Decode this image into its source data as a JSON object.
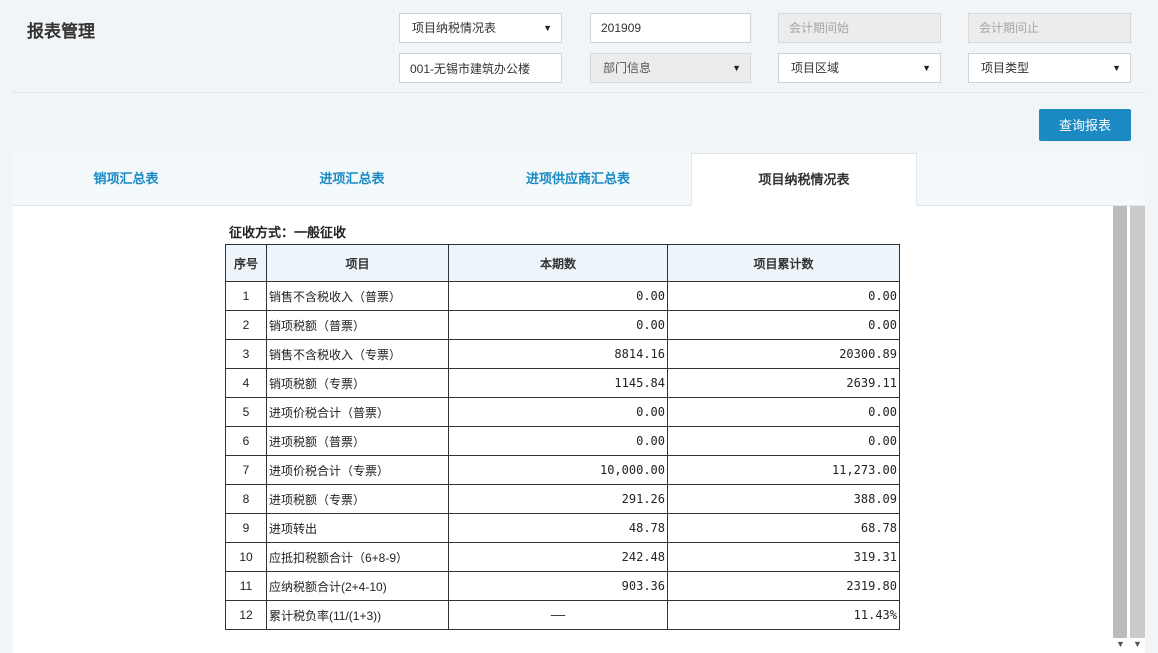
{
  "page": {
    "title": "报表管理"
  },
  "filters": {
    "report_type": {
      "value": "项目纳税情况表"
    },
    "period": {
      "value": "201909"
    },
    "period_start": {
      "placeholder": "会计期间始"
    },
    "period_end": {
      "placeholder": "会计期间止"
    },
    "project": {
      "value": "001-无锡市建筑办公楼"
    },
    "department": {
      "value": "部门信息"
    },
    "region": {
      "value": "项目区域"
    },
    "project_type": {
      "value": "项目类型"
    }
  },
  "query_button": {
    "label": "查询报表"
  },
  "tabs": [
    {
      "label": "销项汇总表",
      "active": false
    },
    {
      "label": "进项汇总表",
      "active": false
    },
    {
      "label": "进项供应商汇总表",
      "active": false
    },
    {
      "label": "项目纳税情况表",
      "active": true
    }
  ],
  "report": {
    "collection_method": "征收方式：一般征收",
    "columns": [
      "序号",
      "项目",
      "本期数",
      "项目累计数"
    ],
    "rows": [
      {
        "no": "1",
        "item": "销售不含税收入（普票）",
        "current": "0.00",
        "cumulative": "0.00"
      },
      {
        "no": "2",
        "item": "销项税额（普票）",
        "current": "0.00",
        "cumulative": "0.00"
      },
      {
        "no": "3",
        "item": "销售不含税收入（专票）",
        "current": "8814.16",
        "cumulative": "20300.89"
      },
      {
        "no": "4",
        "item": "销项税额（专票）",
        "current": "1145.84",
        "cumulative": "2639.11"
      },
      {
        "no": "5",
        "item": "进项价税合计（普票）",
        "current": "0.00",
        "cumulative": "0.00"
      },
      {
        "no": "6",
        "item": "进项税额（普票）",
        "current": "0.00",
        "cumulative": "0.00"
      },
      {
        "no": "7",
        "item": "进项价税合计（专票）",
        "current": "10,000.00",
        "cumulative": "11,273.00"
      },
      {
        "no": "8",
        "item": "进项税额（专票）",
        "current": "291.26",
        "cumulative": "388.09"
      },
      {
        "no": "9",
        "item": "进项转出",
        "current": "48.78",
        "cumulative": "68.78"
      },
      {
        "no": "10",
        "item": "应抵扣税额合计（6+8-9）",
        "current": "242.48",
        "cumulative": "319.31"
      },
      {
        "no": "11",
        "item": "应纳税额合计(2+4-10)",
        "current": "903.36",
        "cumulative": "2319.80"
      },
      {
        "no": "12",
        "item": "累计税负率(11/(1+3))",
        "current": "——",
        "cumulative": "11.43%"
      }
    ]
  },
  "icons": {
    "select_arrow": "chevron-down-icon",
    "scroll_arrow": "chevron-down-icon"
  },
  "colors": {
    "accent": "#1b8ac3",
    "tab_text": "#1a8bc3",
    "header_bg": "#edf5fb",
    "page_bg": "#f2f5f7"
  }
}
